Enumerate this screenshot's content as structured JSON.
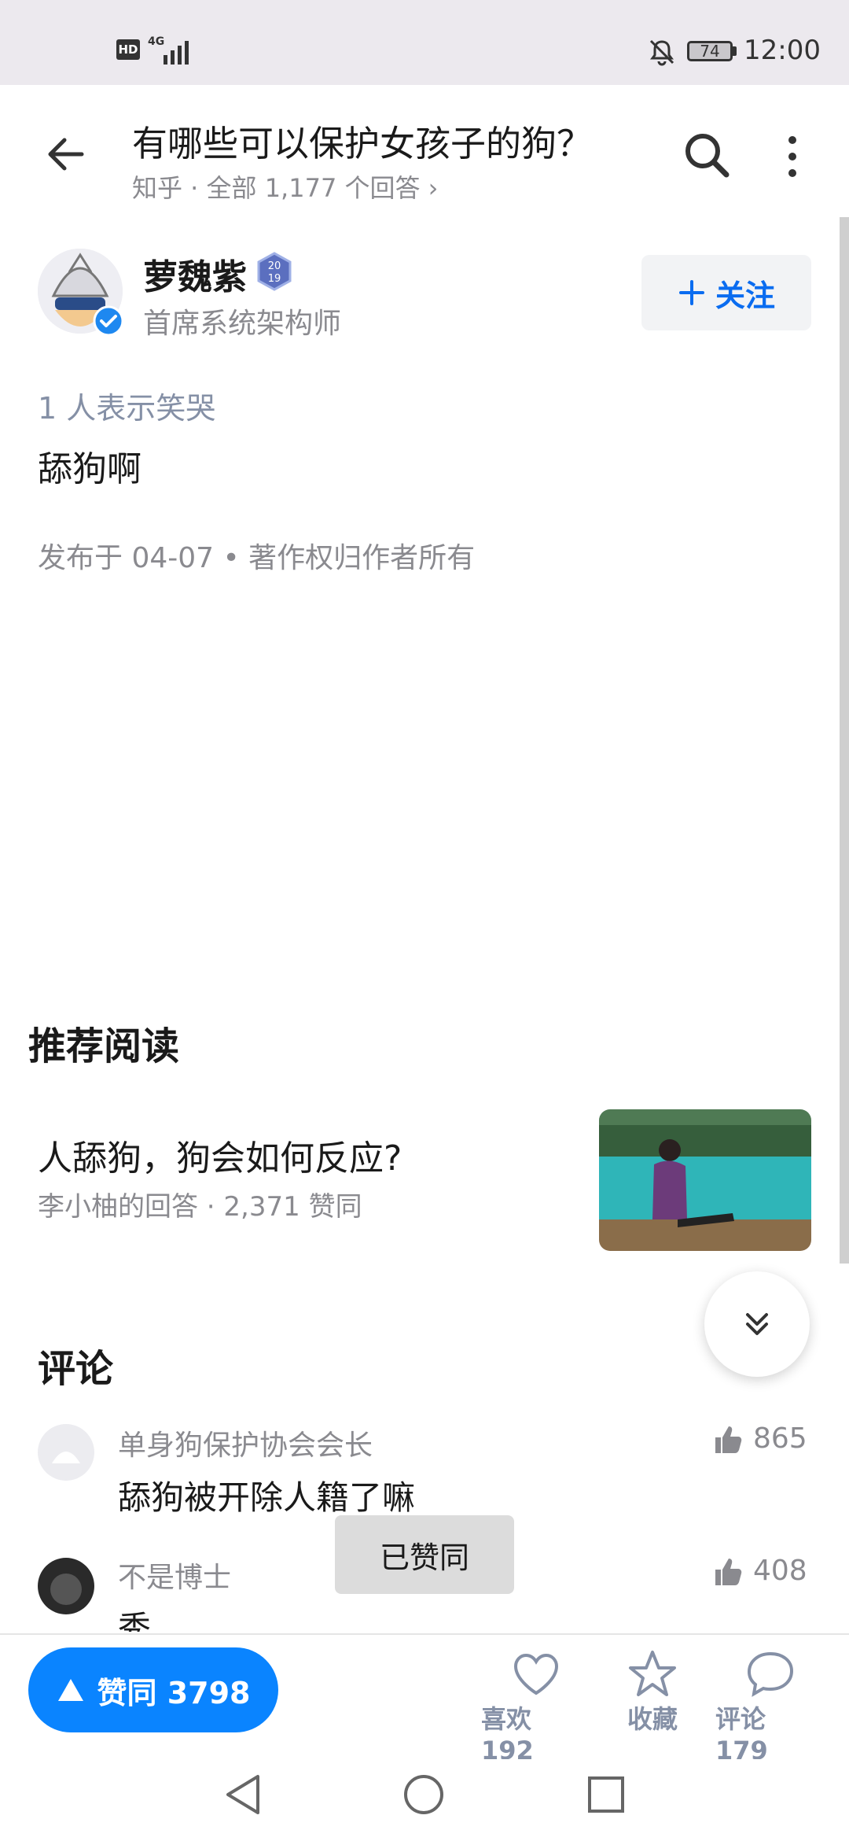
{
  "status_bar": {
    "hd": "HD",
    "network": "4G",
    "battery": "74",
    "time": "12:00"
  },
  "header": {
    "title": "有哪些可以保护女孩子的狗？",
    "subtitle": "知乎 · 全部 1,177 个回答 ›"
  },
  "author": {
    "name": "萝魏紫",
    "title": "首席系统架构师",
    "medal_top": "20",
    "medal_bottom": "19",
    "follow_label": "关注"
  },
  "answer": {
    "reactions": "1 人表示笑哭",
    "text": "舔狗啊",
    "meta": "发布于 04-07 • 著作权归作者所有"
  },
  "recommended": {
    "heading": "推荐阅读",
    "title": "人舔狗，狗会如何反应?",
    "subtitle": "李小柚的回答 · 2,371 赞同"
  },
  "comments": {
    "heading": "评论",
    "items": [
      {
        "name": "单身狗保护协会会长",
        "text": "舔狗被开除人籍了嘛",
        "likes": "865"
      },
      {
        "name": "不是博士",
        "text": "秀",
        "likes": "408"
      }
    ]
  },
  "toast": "已赞同",
  "bottom_bar": {
    "vote_label": "赞同 3798",
    "like_label": "喜欢 192",
    "collect_label": "收藏",
    "comment_label": "评论 179"
  },
  "icons": [
    "back-arrow-icon",
    "search-icon",
    "more-vertical-icon",
    "verified-icon",
    "plus-icon",
    "double-chevron-down-icon",
    "thumbs-up-icon",
    "heart-icon",
    "star-icon",
    "comment-icon",
    "nav-back-icon",
    "nav-home-icon",
    "nav-recents-icon"
  ],
  "colors": {
    "accent": "#0a84ff",
    "link": "#0a6cf0",
    "muted": "#8a8a8f"
  }
}
